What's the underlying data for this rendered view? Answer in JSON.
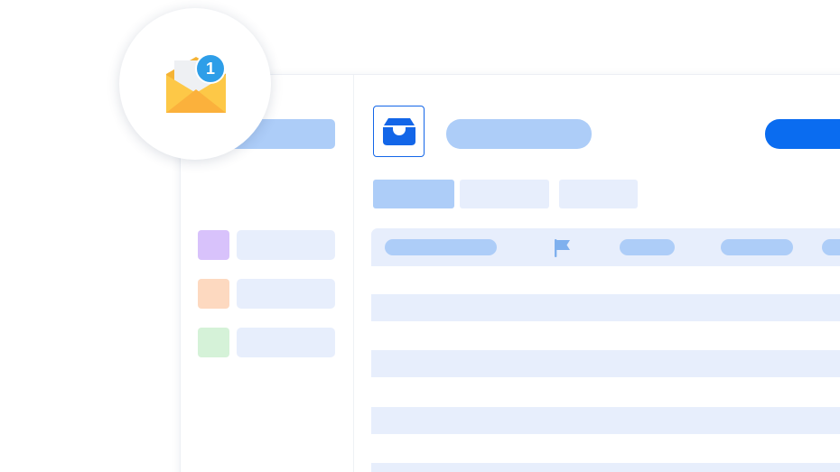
{
  "notification": {
    "count": "1",
    "icon": "open-mail-icon"
  },
  "colors": {
    "accent": "#0a6cf0",
    "skeleton_light": "#e7eefc",
    "skeleton_strong": "#adcdf8",
    "label_purple": "#d8c2fb",
    "label_orange": "#fdd9c0",
    "label_green": "#d5f2d8",
    "badge_blue": "#2e9ee8"
  },
  "header": {
    "inbox_icon": "inbox-tray-icon"
  },
  "table": {
    "flag_icon": "flag-icon"
  }
}
